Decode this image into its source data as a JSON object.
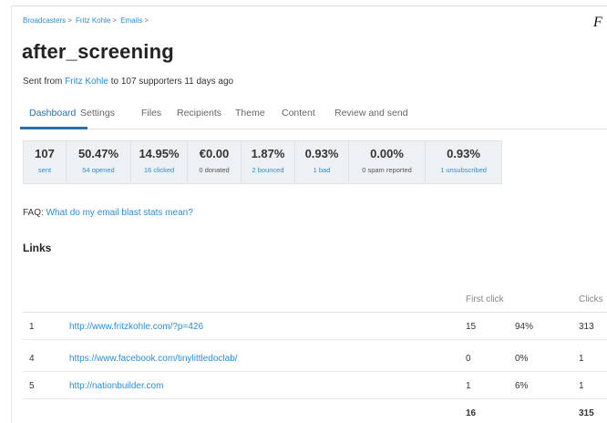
{
  "breadcrumb": [
    "Broadcasters",
    "Fritz Kohle",
    "Emails"
  ],
  "page_title": "after_screening",
  "subline": {
    "prefix": "Sent from",
    "sender": "Fritz Kohle",
    "suffix": "to 107 supporters 11 days ago"
  },
  "corner_mark": "F",
  "tabs": [
    "Dashboard",
    "Settings",
    "Files",
    "Recipients",
    "Theme",
    "Content",
    "Review and send"
  ],
  "active_tab": "Dashboard",
  "stats": [
    {
      "value": "107",
      "label": "sent",
      "link": true
    },
    {
      "value": "50.47%",
      "label": "54 opened",
      "link": true
    },
    {
      "value": "14.95%",
      "label": "16 clicked",
      "link": true
    },
    {
      "value": "€0.00",
      "label": "0 donated",
      "link": false
    },
    {
      "value": "1.87%",
      "label": "2 bounced",
      "link": true
    },
    {
      "value": "0.93%",
      "label": "1 bad",
      "link": true
    },
    {
      "value": "0.00%",
      "label": "0 spam reported",
      "link": false
    },
    {
      "value": "0.93%",
      "label": "1 unsubscribed",
      "link": true
    }
  ],
  "faq": {
    "prefix": "FAQ:",
    "link": "What do my email blast stats mean?"
  },
  "links_heading": "Links",
  "links_table": {
    "headers": {
      "first_click": "First click",
      "clicks": "Clicks"
    },
    "rows": [
      {
        "num": "1",
        "url": "http://www.fritzkohle.com/?p=426",
        "first": "15",
        "pct": "94%",
        "clicks": "313"
      },
      {
        "num": "4",
        "url": "https://www.facebook.com/tinylittledoclab/",
        "first": "0",
        "pct": "0%",
        "clicks": "1"
      },
      {
        "num": "5",
        "url": "http://nationbuilder.com",
        "first": "1",
        "pct": "6%",
        "clicks": "1"
      }
    ],
    "totals": {
      "first": "16",
      "clicks": "315"
    }
  },
  "colors": {
    "link": "#2a8dd4",
    "active_tab": "#2a6fa8",
    "stats_bg": "#eef1f4"
  }
}
